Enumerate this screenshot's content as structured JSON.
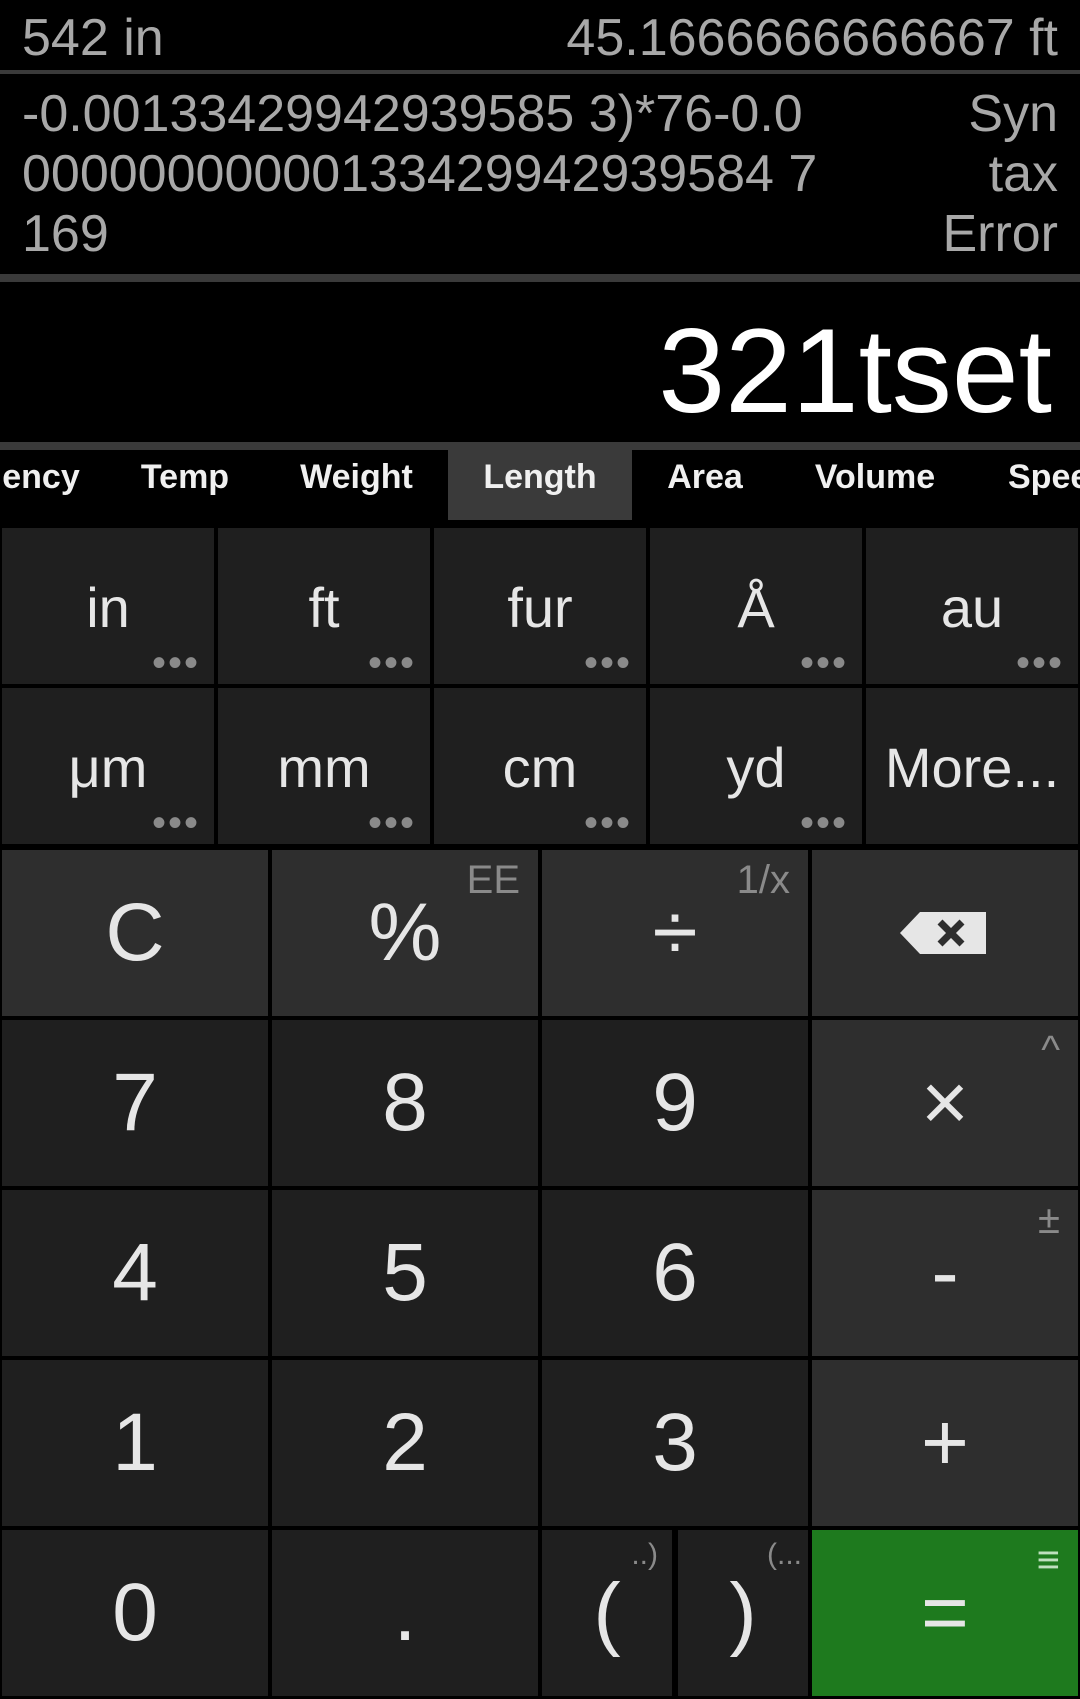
{
  "history": {
    "row1": {
      "expression": "542 in",
      "result": "45.1666666666667 ft"
    },
    "row2": {
      "expression": "-0.00133429942939585 3)*76-0.0 00000000000133429942939584 7169",
      "result": "Syn tax Error"
    }
  },
  "display": {
    "value": "321tset"
  },
  "tabs": [
    {
      "label": "ency"
    },
    {
      "label": "Temp"
    },
    {
      "label": "Weight"
    },
    {
      "label": "Length"
    },
    {
      "label": "Area"
    },
    {
      "label": "Volume"
    },
    {
      "label": "Spee"
    }
  ],
  "active_tab": "Length",
  "units": [
    {
      "label": "in",
      "dots": "•••"
    },
    {
      "label": "ft",
      "dots": "•••"
    },
    {
      "label": "fur",
      "dots": "•••"
    },
    {
      "label": "Å",
      "dots": "•••"
    },
    {
      "label": "au",
      "dots": "•••"
    },
    {
      "label": "μm",
      "dots": "•••"
    },
    {
      "label": "mm",
      "dots": "•••"
    },
    {
      "label": "cm",
      "dots": "•••"
    },
    {
      "label": "yd",
      "dots": "•••"
    },
    {
      "label": "More...",
      "dots": ""
    }
  ],
  "keys": {
    "clear": {
      "label": "C"
    },
    "percent": {
      "label": "%",
      "sub": "EE"
    },
    "divide": {
      "label": "÷",
      "sub": "1/x"
    },
    "backspace": {
      "label": "⌫"
    },
    "seven": {
      "label": "7"
    },
    "eight": {
      "label": "8"
    },
    "nine": {
      "label": "9"
    },
    "multiply": {
      "label": "×",
      "sub": "^"
    },
    "four": {
      "label": "4"
    },
    "five": {
      "label": "5"
    },
    "six": {
      "label": "6"
    },
    "minus": {
      "label": "-",
      "sub": "±"
    },
    "one": {
      "label": "1"
    },
    "two": {
      "label": "2"
    },
    "three": {
      "label": "3"
    },
    "plus": {
      "label": "+"
    },
    "zero": {
      "label": "0"
    },
    "decimal": {
      "label": "."
    },
    "open_paren": {
      "label": "(",
      "sub": "..)"
    },
    "close_paren": {
      "label": ")",
      "sub": "(..."
    },
    "equals": {
      "label": "=",
      "sub": "≡"
    }
  },
  "colors": {
    "equals_bg": "#1e7a1e",
    "active_tab_bg": "#3a3a3a"
  }
}
